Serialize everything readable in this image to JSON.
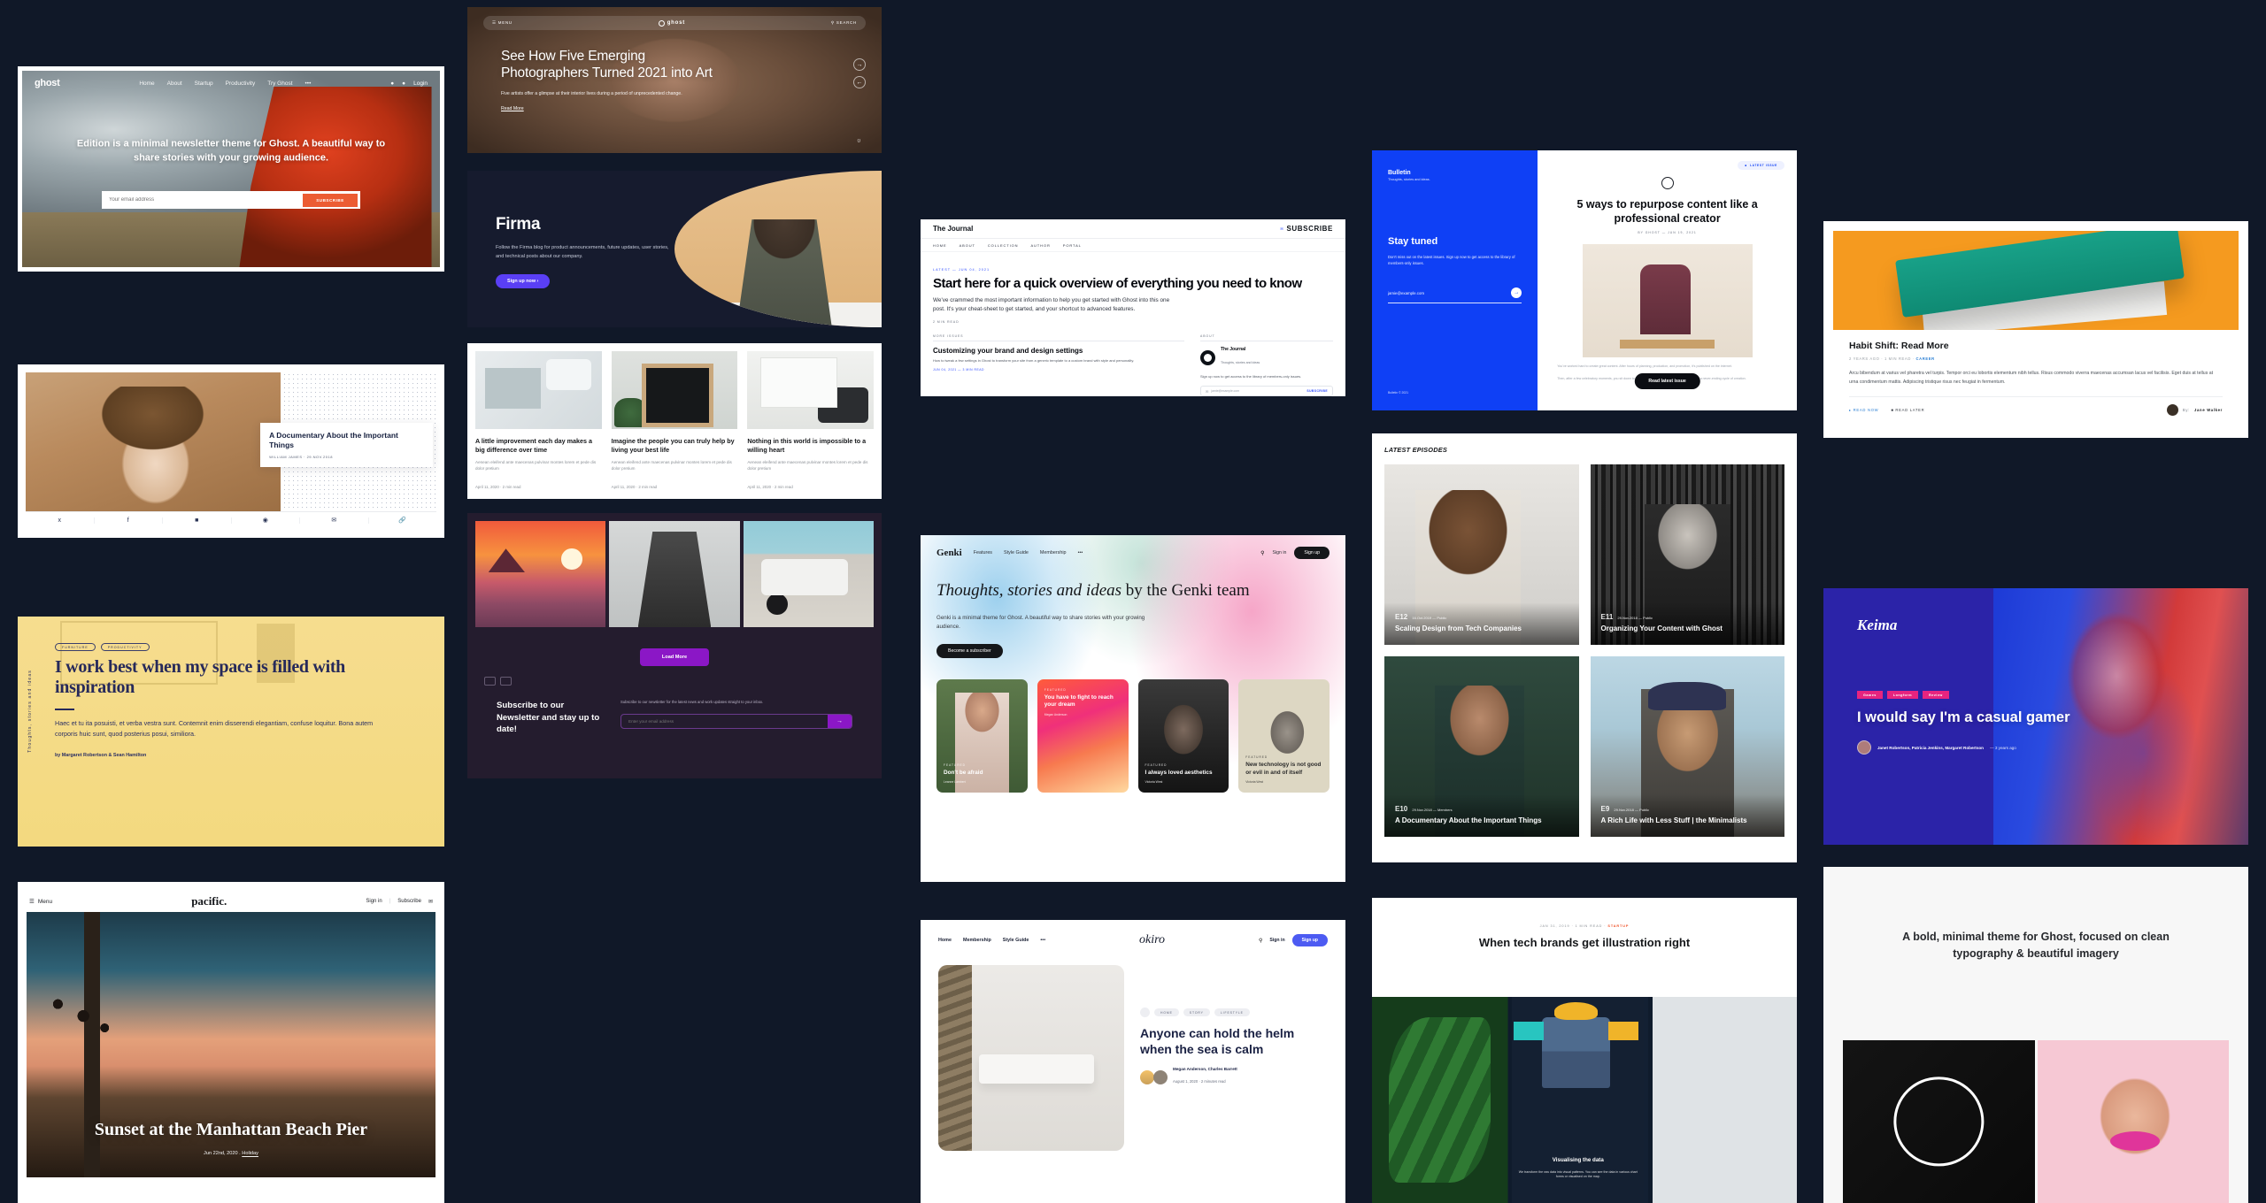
{
  "background_color": "#101828",
  "page": {
    "title": "Ghost themes gallery"
  },
  "cards": {
    "edition": {
      "brand": "ghost",
      "nav": [
        "Home",
        "About",
        "Startup",
        "Productivity",
        "Try Ghost",
        "•••"
      ],
      "right": [
        "Login"
      ],
      "icons": {
        "facebook": "f",
        "twitter": "t"
      },
      "headline": "Edition is a minimal newsletter theme for Ghost. A beautiful way to share stories with your growing audience.",
      "email_placeholder": "Your email address",
      "subscribe_label": "SUBSCRIBE"
    },
    "documentary": {
      "title": "A Documentary About the Important Things",
      "meta": "WILLIAM JAMES  ·  29.NOV.2018",
      "social": [
        "twitter-icon",
        "facebook-icon",
        "linkedin-icon",
        "pinterest-icon",
        "email-icon",
        "link-icon"
      ]
    },
    "yellow": {
      "vertical_label": "Thoughts, stories and ideas",
      "tags": [
        "FURNITURE",
        "PRODUCTIVITY"
      ],
      "title": "I work best when my space is filled with inspiration",
      "excerpt": "Haec et tu ita posuisti, et verba vestra sunt. Contemnit enim disserendi elegantiam, confuse loquitur. Bona autem corporis huic sunt, quod posterius posui, similiora.",
      "byline": "by Margaret Robertson & Sean Hamilton"
    },
    "pacific": {
      "menu_label": "Menu",
      "logo": "pacific.",
      "signin": "Sign in",
      "subscribe": "Subscribe",
      "title": "Sunset at the Manhattan Beach Pier",
      "date": "Jun 22nd, 2020",
      "separator": ".",
      "tag": "Holiday"
    },
    "ease": {
      "menu_label": "MENU",
      "brand": "ghost",
      "search_label": "SEARCH",
      "title": "See How Five Emerging Photographers Turned 2021 into Art",
      "excerpt": "Five artists offer a glimpse at their interior lives during a period of unprecedented change.",
      "read_more": "Read More",
      "counter": "0"
    },
    "firma": {
      "title": "Firma",
      "description": "Follow the Firma blog for product announcements, future updates, user stories, and technical posts about our company.",
      "cta": "Sign up now  ›"
    },
    "posts3": {
      "items": [
        {
          "title": "A little improvement each day makes a big difference over time",
          "excerpt": "Aenean eleifend ante maecenas pulvinar montes lorem et pede dis dolor  pretium",
          "meta": "April 11, 2020   ·   2 min read"
        },
        {
          "title": "Imagine the people you can truly help by living your best life",
          "excerpt": "Aenean eleifend ante maecenas pulvinar montes lorem et pede dis dolor  pretium",
          "meta": "April 11, 2020   ·   2 min read"
        },
        {
          "title": "Nothing in this world is impossible to a willing heart",
          "excerpt": "Aenean eleifend ante maecenas pulvinar montes lorem et pede dis dolor  pretium",
          "meta": "April 11, 2020   ·   2 min read"
        }
      ]
    },
    "dark": {
      "load_more": "Load More",
      "subscribe_title": "Subscribe to our Newsletter and stay up to date!",
      "subscribe_copy": "Subscribe to our newsletter for the latest news and work updates straight to your inbox.",
      "email_placeholder": "Enter your email address",
      "submit_icon": "→"
    },
    "journal": {
      "brand": "The Journal",
      "subscribe": "SUBSCRIBE",
      "nav": [
        "HOME",
        "ABOUT",
        "COLLECTION",
        "AUTHOR",
        "PORTAL"
      ],
      "kicker": "LATEST — JUN 04, 2021",
      "title": "Start here for a quick overview of everything you need to know",
      "excerpt": "We've crammed the most important information to help you get started with Ghost into this one post. It's your cheat-sheet to get started, and your shortcut to advanced features.",
      "read_time": "2 MIN READ",
      "more_label": "MORE ISSUES",
      "more_title": "Customizing your brand and design settings",
      "more_excerpt": "How to tweak a few settings in Ghost to transform your site from a generic template to a custom brand with style and personality.",
      "more_meta": "JUN 04, 2021 — 3 MIN READ",
      "about_label": "ABOUT",
      "about_name": "The Journal",
      "about_tagline": "Thoughts, stories and ideas",
      "about_copy": "Sign up now to get access to the library of members-only issues.",
      "about_placeholder": "jamie@example.com",
      "about_cta": "SUBSCRIBE"
    },
    "genki": {
      "brand": "Genki",
      "nav": [
        "Features",
        "Style Guide",
        "Membership",
        "•••"
      ],
      "search_icon": "search-icon",
      "signin": "Sign in",
      "signup": "Sign up",
      "title_em": "Thoughts, stories and ideas",
      "title_rest": " by the Genki team",
      "lede": "Genki is a minimal theme for Ghost. A beautiful way to share stories with your growing audience.",
      "cta": "Become a subscriber",
      "cards": [
        {
          "kicker": "FEATURED",
          "title": "Don't be afraid",
          "author": "Leanne Lambert"
        },
        {
          "kicker": "FEATURED",
          "title": "You have to fight to reach your dream",
          "author": "Megan Anderson"
        },
        {
          "kicker": "FEATURED",
          "title": "I always loved aesthetics",
          "author": "Victoria West"
        },
        {
          "kicker": "FEATURED",
          "title": "New technology is not good or evil in and of itself",
          "author": "Victoria West"
        }
      ]
    },
    "okiro": {
      "nav": [
        "Home",
        "Membership",
        "Style Guide",
        "•••"
      ],
      "brand": "okiro",
      "signin": "Sign in",
      "signup": "Sign up",
      "tags": [
        "HOME",
        "STORY",
        "LIFESTYLE"
      ],
      "title": "Anyone can hold the helm when the sea is calm",
      "authors": "Megan Anderson, Charles Barrett",
      "meta": "August 1, 2020 · 2 minutes read"
    },
    "bulletin": {
      "brand": "Bulletin",
      "tagline": "Thoughts, stories and ideas.",
      "stay_title": "Stay tuned",
      "stay_copy": "Don't miss out on the latest issues. Sign up now to get access to the library of members-only issues.",
      "email_value": "jamie@example.com",
      "submit_icon": "→",
      "footer": "Bulletin © 2021",
      "badge": "LATEST ISSUE",
      "title": "5 ways to repurpose content like a professional creator",
      "byline": "BY GHOST — JUN 19, 2021",
      "body1": "You've worked hard to create great content. After hours of planning, production, and promotion, it's published on the internet.",
      "body2": "Then, after a few celebratory moments, you sit down to start working on the next piece of content. It's a never-ending cycle of creation.",
      "read_cta": "Read latest issue"
    },
    "episodes": {
      "section_title": "LATEST EPISODES",
      "items": [
        {
          "num": "E12",
          "date": "16.Oct.2019",
          "sep": "—",
          "access": "Public",
          "title": "Scaling Design from Tech Companies"
        },
        {
          "num": "E11",
          "date": "29.Nov.2018",
          "sep": "—",
          "access": "Public",
          "title": "Organizing Your Content with Ghost"
        },
        {
          "num": "E10",
          "date": "29.Nov.2018",
          "sep": "—",
          "access": "Members",
          "title": "A Documentary About the Important Things"
        },
        {
          "num": "E9",
          "date": "29.Nov.2018",
          "sep": "—",
          "access": "Public",
          "title": "A Rich Life with Less Stuff | the Minimalists"
        }
      ]
    },
    "illustration": {
      "meta_date": "JAN 31, 2019",
      "meta_read": "1 MIN READ",
      "meta_tag": "STARTUP",
      "title": "When tech brands get illustration right",
      "phone_title": "Visualising the data",
      "phone_copy": "We transform the raw data into visual patterns. You can see the data in various chart forms or visualised on the map."
    },
    "habit": {
      "title": "Habit Shift: Read More",
      "meta_age": "2 YEARS AGO",
      "meta_read": "1 MIN READ",
      "meta_tag": "CAREER",
      "excerpt": "Arcu bibendum at varius vel pharetra vel turpis. Tempor orci eu lobortis elementum nibh tellus. Risus commodo viverra maecenas accumsan lacus vel facilisis. Eget duis at tellus at urna condimentum mattis. Adipiscing tristique risus nec feugiat in fermentum.",
      "read_now": "READ NOW",
      "read_later": "READ LATER",
      "author_prefix": "By:",
      "author": "Jane Walker"
    },
    "keima": {
      "brand": "Keima",
      "tags": [
        "Games",
        "Longform",
        "Review"
      ],
      "title": "I would say I'm a casual gamer",
      "authors": "Janet Robertson, Patricia Jenkins, Margaret Robertson",
      "meta": "— 3 years ago"
    },
    "bold": {
      "title": "A bold, minimal theme for Ghost, focused on clean typography & beautiful imagery"
    }
  }
}
